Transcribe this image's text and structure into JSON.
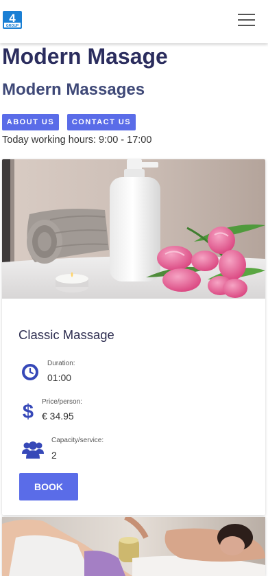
{
  "navbar": {
    "logo_text": "4",
    "logo_subtext": "GROUP"
  },
  "page": {
    "title": "Modern Masage",
    "subtitle": "Modern Massages",
    "about_label": "ABOUT US",
    "contact_label": "CONTACT US",
    "working_hours": "Today working hours: 9:00 - 17:00"
  },
  "service": {
    "title": "Classic Massage",
    "duration_label": "Duration:",
    "duration_value": "01:00",
    "price_label": "Price/person:",
    "price_value": "€ 34.95",
    "capacity_label": "Capacity/service:",
    "capacity_value": "2",
    "book_label": "BOOK"
  },
  "colors": {
    "accent": "#5a6ce8",
    "icon": "#3648b8",
    "title": "#2b2d5e"
  },
  "icons": {
    "menu": "hamburger-icon",
    "duration": "clock-icon",
    "price": "dollar-icon",
    "capacity": "users-icon"
  }
}
